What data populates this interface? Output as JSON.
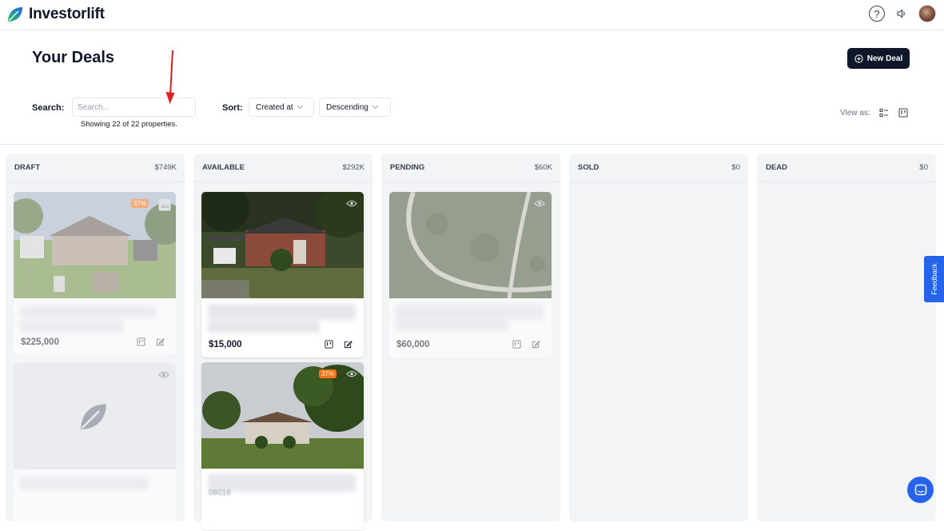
{
  "app": {
    "name": "Investorlift"
  },
  "header": {
    "title": "Your Deals",
    "new_deal_label": "New Deal"
  },
  "filters": {
    "search_label": "Search:",
    "search_placeholder": "Search...",
    "search_value": "",
    "showing_text": "Showing 22 of 22 properties.",
    "sort_label": "Sort:",
    "sort_field": "Created at",
    "sort_order": "Descending",
    "view_as_label": "View as:"
  },
  "columns": [
    {
      "name": "DRAFT",
      "total": "$749K"
    },
    {
      "name": "AVAILABLE",
      "total": "$292K"
    },
    {
      "name": "PENDING",
      "total": "$60K"
    },
    {
      "name": "SOLD",
      "total": "$0"
    },
    {
      "name": "DEAD",
      "total": "$0"
    }
  ],
  "cards": {
    "draft_1": {
      "price": "$225,000",
      "badge": "37%"
    },
    "available_1": {
      "price": "$15,000"
    },
    "available_2": {
      "badge": "37%",
      "blurred_id": "08016"
    },
    "pending_1": {
      "price": "$60,000"
    }
  },
  "widgets": {
    "feedback_label": "Feedback"
  },
  "colors": {
    "primary": "#0f172a",
    "accent": "#2563eb",
    "badge": "#f97316",
    "annotation_arrow": "#e11d1d"
  }
}
